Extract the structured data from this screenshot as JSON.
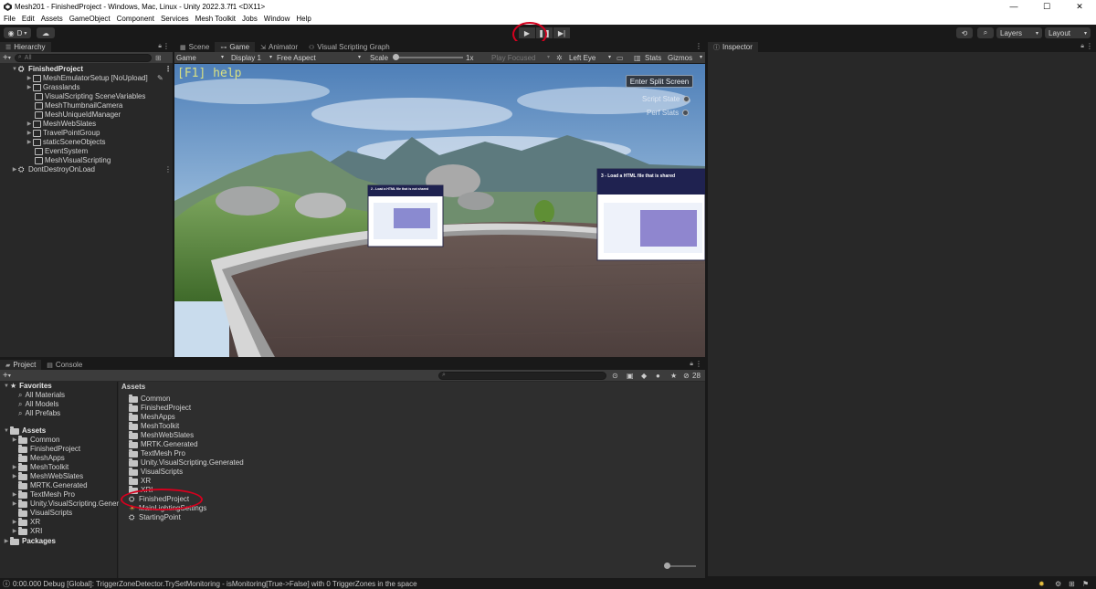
{
  "window": {
    "title": "Mesh201 - FinishedProject - Windows, Mac, Linux - Unity 2022.3.7f1 <DX11>",
    "controls": [
      "—",
      "☐",
      "✕"
    ]
  },
  "menu": [
    "File",
    "Edit",
    "Assets",
    "GameObject",
    "Component",
    "Services",
    "Mesh Toolkit",
    "Jobs",
    "Window",
    "Help"
  ],
  "toolbar": {
    "account_label": "D",
    "layers_label": "Layers",
    "layout_label": "Layout",
    "play_icon": "play-icon",
    "pause_icon": "pause-icon",
    "step_icon": "step-icon"
  },
  "hierarchy": {
    "tab_label": "Hierarchy",
    "search_placeholder": "All",
    "items": [
      {
        "label": "FinishedProject",
        "depth": 0,
        "kind": "scene",
        "expanded": true
      },
      {
        "label": "MeshEmulatorSetup [NoUpload]",
        "depth": 1,
        "kind": "object"
      },
      {
        "label": "Grasslands",
        "depth": 1,
        "kind": "object"
      },
      {
        "label": "VisualScripting SceneVariables",
        "depth": 1,
        "kind": "object"
      },
      {
        "label": "MeshThumbnailCamera",
        "depth": 1,
        "kind": "object"
      },
      {
        "label": "MeshUniqueIdManager",
        "depth": 1,
        "kind": "object"
      },
      {
        "label": "MeshWebSlates",
        "depth": 1,
        "kind": "object"
      },
      {
        "label": "TravelPointGroup",
        "depth": 1,
        "kind": "object"
      },
      {
        "label": "staticSceneObjects",
        "depth": 1,
        "kind": "object"
      },
      {
        "label": "EventSystem",
        "depth": 1,
        "kind": "object"
      },
      {
        "label": "MeshVisualScripting",
        "depth": 1,
        "kind": "object"
      },
      {
        "label": "DontDestroyOnLoad",
        "depth": 0,
        "kind": "scene"
      }
    ]
  },
  "center_tabs": [
    {
      "label": "Scene",
      "active": false
    },
    {
      "label": "Game",
      "active": true
    },
    {
      "label": "Animator",
      "active": false
    },
    {
      "label": "Visual Scripting Graph",
      "active": false
    }
  ],
  "game_toolbar": {
    "mode": "Game",
    "display": "Display 1",
    "aspect": "Free Aspect",
    "scale_label": "Scale",
    "scale_value": "1x",
    "play_focused": "Play Focused",
    "eye": "Left Eye",
    "stats": "Stats",
    "gizmos": "Gizmos"
  },
  "game_view": {
    "help_text": "[F1] help",
    "split_button": "Enter Split Screen",
    "script_state": "Script State",
    "perf_stats": "Perf Stats",
    "slate_left_title": "2 - Load a HTML file that is not shared",
    "slate_right_title": "3 - Load a HTML file that is shared"
  },
  "inspector": {
    "tab_label": "Inspector"
  },
  "bottom_tabs": [
    {
      "label": "Project",
      "active": true
    },
    {
      "label": "Console",
      "active": false
    }
  ],
  "project_tree": {
    "favorites_label": "Favorites",
    "favorites": [
      "All Materials",
      "All Models",
      "All Prefabs"
    ],
    "assets_label": "Assets",
    "assets": [
      "Common",
      "FinishedProject",
      "MeshApps",
      "MeshToolkit",
      "MeshWebSlates",
      "MRTK.Generated",
      "TextMesh Pro",
      "Unity.VisualScripting.Genera",
      "VisualScripts",
      "XR",
      "XRI"
    ],
    "packages_label": "Packages"
  },
  "assets_panel": {
    "breadcrumb": "Assets",
    "count": "28",
    "folders": [
      "Common",
      "FinishedProject",
      "MeshApps",
      "MeshToolkit",
      "MeshWebSlates",
      "MRTK.Generated",
      "TextMesh Pro",
      "Unity.VisualScripting.Generated",
      "VisualScripts",
      "XR",
      "XRI"
    ],
    "scenes": [
      "FinishedProject",
      "MainLightingSettings",
      "StartingPoint"
    ]
  },
  "status_bar": {
    "message": "0:00.000 Debug [Global]: TriggerZoneDetector.TrySetMonitoring - isMonitoring[True->False] with 0 TriggerZones in the space"
  },
  "colors": {
    "accent_play": "#1e4066",
    "annotation_red": "#d5001e"
  }
}
